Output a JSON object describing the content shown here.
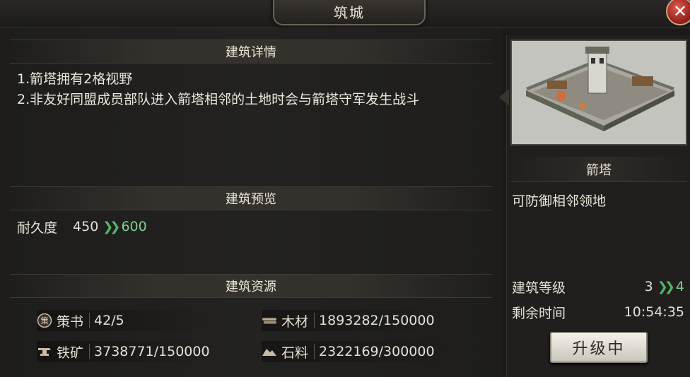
{
  "window": {
    "title": "筑城",
    "close_label": "✕"
  },
  "details": {
    "header": "建筑详情",
    "lines": [
      "1.箭塔拥有2格视野",
      "2.非友好同盟成员部队进入箭塔相邻的土地时会与箭塔守军发生战斗"
    ]
  },
  "preview": {
    "header": "建筑预览",
    "label": "耐久度",
    "current": "450",
    "next": "600"
  },
  "resources": {
    "header": "建筑资源",
    "items": [
      {
        "label": "策书",
        "value": "42/5",
        "icon": "book-icon",
        "glyph": "策"
      },
      {
        "label": "木材",
        "value": "1893282/150000",
        "icon": "wood-icon"
      },
      {
        "label": "铁矿",
        "value": "3738771/150000",
        "icon": "iron-icon"
      },
      {
        "label": "石料",
        "value": "2322169/300000",
        "icon": "stone-icon"
      }
    ]
  },
  "building": {
    "name": "箭塔",
    "description": "可防御相邻领地",
    "level_label": "建筑等级",
    "level_current": "3",
    "level_next": "4",
    "time_label": "剩余时间",
    "time_value": "10:54:35",
    "button_label": "升级中"
  },
  "colors": {
    "accent_green": "#55b56a",
    "value_green": "#7fcf8d",
    "close_red": "#b3271f"
  }
}
